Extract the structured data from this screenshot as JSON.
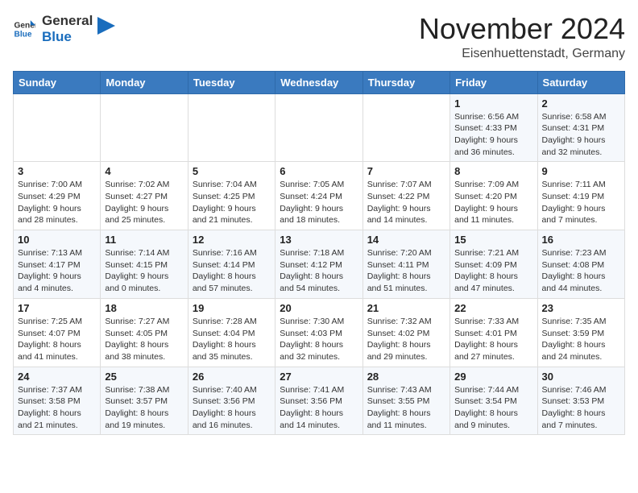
{
  "header": {
    "logo_general": "General",
    "logo_blue": "Blue",
    "month": "November 2024",
    "location": "Eisenhuettenstadt, Germany"
  },
  "weekdays": [
    "Sunday",
    "Monday",
    "Tuesday",
    "Wednesday",
    "Thursday",
    "Friday",
    "Saturday"
  ],
  "weeks": [
    [
      {
        "day": "",
        "info": ""
      },
      {
        "day": "",
        "info": ""
      },
      {
        "day": "",
        "info": ""
      },
      {
        "day": "",
        "info": ""
      },
      {
        "day": "",
        "info": ""
      },
      {
        "day": "1",
        "info": "Sunrise: 6:56 AM\nSunset: 4:33 PM\nDaylight: 9 hours\nand 36 minutes."
      },
      {
        "day": "2",
        "info": "Sunrise: 6:58 AM\nSunset: 4:31 PM\nDaylight: 9 hours\nand 32 minutes."
      }
    ],
    [
      {
        "day": "3",
        "info": "Sunrise: 7:00 AM\nSunset: 4:29 PM\nDaylight: 9 hours\nand 28 minutes."
      },
      {
        "day": "4",
        "info": "Sunrise: 7:02 AM\nSunset: 4:27 PM\nDaylight: 9 hours\nand 25 minutes."
      },
      {
        "day": "5",
        "info": "Sunrise: 7:04 AM\nSunset: 4:25 PM\nDaylight: 9 hours\nand 21 minutes."
      },
      {
        "day": "6",
        "info": "Sunrise: 7:05 AM\nSunset: 4:24 PM\nDaylight: 9 hours\nand 18 minutes."
      },
      {
        "day": "7",
        "info": "Sunrise: 7:07 AM\nSunset: 4:22 PM\nDaylight: 9 hours\nand 14 minutes."
      },
      {
        "day": "8",
        "info": "Sunrise: 7:09 AM\nSunset: 4:20 PM\nDaylight: 9 hours\nand 11 minutes."
      },
      {
        "day": "9",
        "info": "Sunrise: 7:11 AM\nSunset: 4:19 PM\nDaylight: 9 hours\nand 7 minutes."
      }
    ],
    [
      {
        "day": "10",
        "info": "Sunrise: 7:13 AM\nSunset: 4:17 PM\nDaylight: 9 hours\nand 4 minutes."
      },
      {
        "day": "11",
        "info": "Sunrise: 7:14 AM\nSunset: 4:15 PM\nDaylight: 9 hours\nand 0 minutes."
      },
      {
        "day": "12",
        "info": "Sunrise: 7:16 AM\nSunset: 4:14 PM\nDaylight: 8 hours\nand 57 minutes."
      },
      {
        "day": "13",
        "info": "Sunrise: 7:18 AM\nSunset: 4:12 PM\nDaylight: 8 hours\nand 54 minutes."
      },
      {
        "day": "14",
        "info": "Sunrise: 7:20 AM\nSunset: 4:11 PM\nDaylight: 8 hours\nand 51 minutes."
      },
      {
        "day": "15",
        "info": "Sunrise: 7:21 AM\nSunset: 4:09 PM\nDaylight: 8 hours\nand 47 minutes."
      },
      {
        "day": "16",
        "info": "Sunrise: 7:23 AM\nSunset: 4:08 PM\nDaylight: 8 hours\nand 44 minutes."
      }
    ],
    [
      {
        "day": "17",
        "info": "Sunrise: 7:25 AM\nSunset: 4:07 PM\nDaylight: 8 hours\nand 41 minutes."
      },
      {
        "day": "18",
        "info": "Sunrise: 7:27 AM\nSunset: 4:05 PM\nDaylight: 8 hours\nand 38 minutes."
      },
      {
        "day": "19",
        "info": "Sunrise: 7:28 AM\nSunset: 4:04 PM\nDaylight: 8 hours\nand 35 minutes."
      },
      {
        "day": "20",
        "info": "Sunrise: 7:30 AM\nSunset: 4:03 PM\nDaylight: 8 hours\nand 32 minutes."
      },
      {
        "day": "21",
        "info": "Sunrise: 7:32 AM\nSunset: 4:02 PM\nDaylight: 8 hours\nand 29 minutes."
      },
      {
        "day": "22",
        "info": "Sunrise: 7:33 AM\nSunset: 4:01 PM\nDaylight: 8 hours\nand 27 minutes."
      },
      {
        "day": "23",
        "info": "Sunrise: 7:35 AM\nSunset: 3:59 PM\nDaylight: 8 hours\nand 24 minutes."
      }
    ],
    [
      {
        "day": "24",
        "info": "Sunrise: 7:37 AM\nSunset: 3:58 PM\nDaylight: 8 hours\nand 21 minutes."
      },
      {
        "day": "25",
        "info": "Sunrise: 7:38 AM\nSunset: 3:57 PM\nDaylight: 8 hours\nand 19 minutes."
      },
      {
        "day": "26",
        "info": "Sunrise: 7:40 AM\nSunset: 3:56 PM\nDaylight: 8 hours\nand 16 minutes."
      },
      {
        "day": "27",
        "info": "Sunrise: 7:41 AM\nSunset: 3:56 PM\nDaylight: 8 hours\nand 14 minutes."
      },
      {
        "day": "28",
        "info": "Sunrise: 7:43 AM\nSunset: 3:55 PM\nDaylight: 8 hours\nand 11 minutes."
      },
      {
        "day": "29",
        "info": "Sunrise: 7:44 AM\nSunset: 3:54 PM\nDaylight: 8 hours\nand 9 minutes."
      },
      {
        "day": "30",
        "info": "Sunrise: 7:46 AM\nSunset: 3:53 PM\nDaylight: 8 hours\nand 7 minutes."
      }
    ]
  ]
}
